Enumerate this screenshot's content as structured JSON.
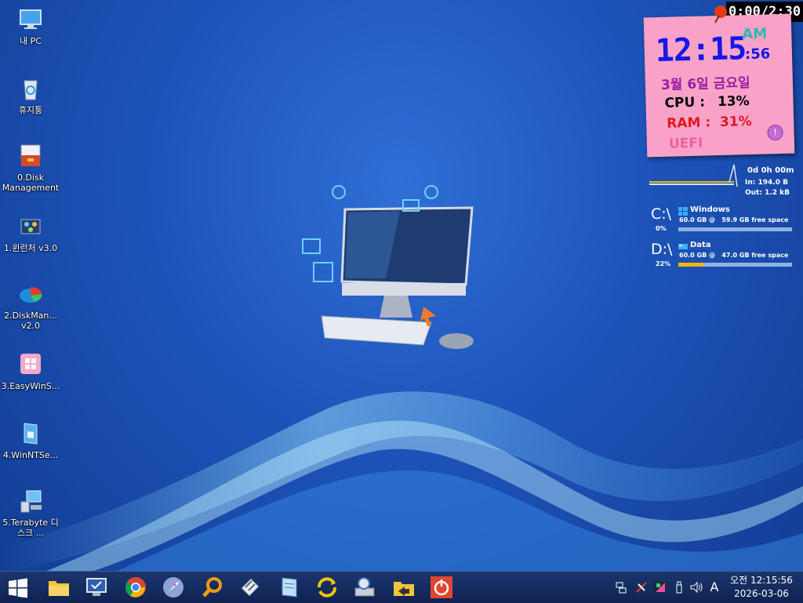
{
  "desktop": {
    "icons": [
      {
        "label": "내 PC",
        "icon": "monitor-icon"
      },
      {
        "label": "휴지통",
        "icon": "recycle-bin-icon"
      },
      {
        "label": "0.Disk Management",
        "icon": "toolbox-icon"
      },
      {
        "label": "1.윈런처 v3.0",
        "icon": "launcher-icon"
      },
      {
        "label": "2.DiskMan... v2.0",
        "icon": "disk-pie-icon"
      },
      {
        "label": "3.EasyWinS...",
        "icon": "windows-tile-icon"
      },
      {
        "label": "4.WinNTSe...",
        "icon": "install-box-icon"
      },
      {
        "label": "5.Terabyte 디스크 ...",
        "icon": "computer-disk-icon"
      }
    ]
  },
  "sticky_clock": {
    "timer": "0:00/2:30",
    "time": "12:15",
    "ampm": "AM",
    "seconds": ":56",
    "date": "3월 6일 금요일",
    "cpu_label": "CPU :",
    "cpu_value": "13%",
    "ram_label": "RAM :",
    "ram_value": "31%",
    "boot_mode": "UEFI",
    "info_icon": "info-icon",
    "colors": {
      "paper": "#f9a2c7",
      "time": "#1616e6",
      "date": "#9a1ba0",
      "ram": "#e0151f",
      "uefi": "#ee5ea4"
    }
  },
  "network": {
    "uptime": "0d 0h 00m",
    "in": "In: 194.0 B",
    "out": "Out: 1.2 kB"
  },
  "drives": [
    {
      "letter": "C:\\",
      "name": "Windows",
      "size": "60.0 GB @",
      "free": "59.9 GB free space",
      "percent": "0%",
      "used_fraction": 0.0
    },
    {
      "letter": "D:\\",
      "name": "Data",
      "size": "60.0 GB @",
      "free": "47.0 GB free space",
      "percent": "22%",
      "used_fraction": 0.22
    }
  ],
  "taskbar": {
    "start_icon": "windows-start-icon",
    "apps": [
      "file-explorer-icon",
      "monitor-check-icon",
      "chrome-icon",
      "rocket-icon",
      "magnifier-icon",
      "tools-icon",
      "notebook-icon",
      "sync-arrows-icon",
      "disk-tool-icon",
      "folder-arrow-icon",
      "power-icon"
    ],
    "tray": {
      "icons": [
        "network-icon",
        "tools-tray-icon",
        "color-tray-icon",
        "usb-icon",
        "volume-icon"
      ],
      "ime": "A",
      "time": "오전 12:15:56",
      "date": "2026-03-06"
    }
  }
}
